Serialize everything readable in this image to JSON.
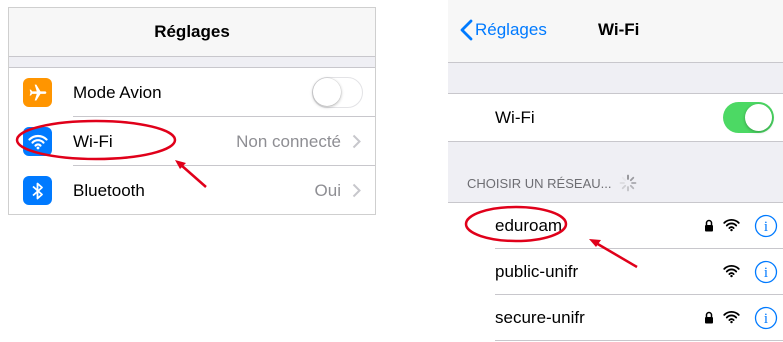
{
  "left": {
    "title": "Réglages",
    "rows": [
      {
        "label": "Mode Avion",
        "icon": "airplane-icon",
        "icon_color": "#ff9500"
      },
      {
        "label": "Wi-Fi",
        "value": "Non connecté",
        "icon": "wifi-icon",
        "icon_color": "#007aff"
      },
      {
        "label": "Bluetooth",
        "value": "Oui",
        "icon": "bluetooth-icon",
        "icon_color": "#007aff"
      }
    ]
  },
  "right": {
    "back_label": "Réglages",
    "title": "Wi-Fi",
    "wifi_label": "Wi-Fi",
    "section_header": "CHOISIR UN RÉSEAU...",
    "networks": [
      {
        "name": "eduroam",
        "locked": true
      },
      {
        "name": "public-unifr",
        "locked": false
      },
      {
        "name": "secure-unifr",
        "locked": true
      }
    ]
  },
  "colors": {
    "accent": "#007aff",
    "toggle_on": "#4cd964",
    "annotation": "#e0001a"
  }
}
